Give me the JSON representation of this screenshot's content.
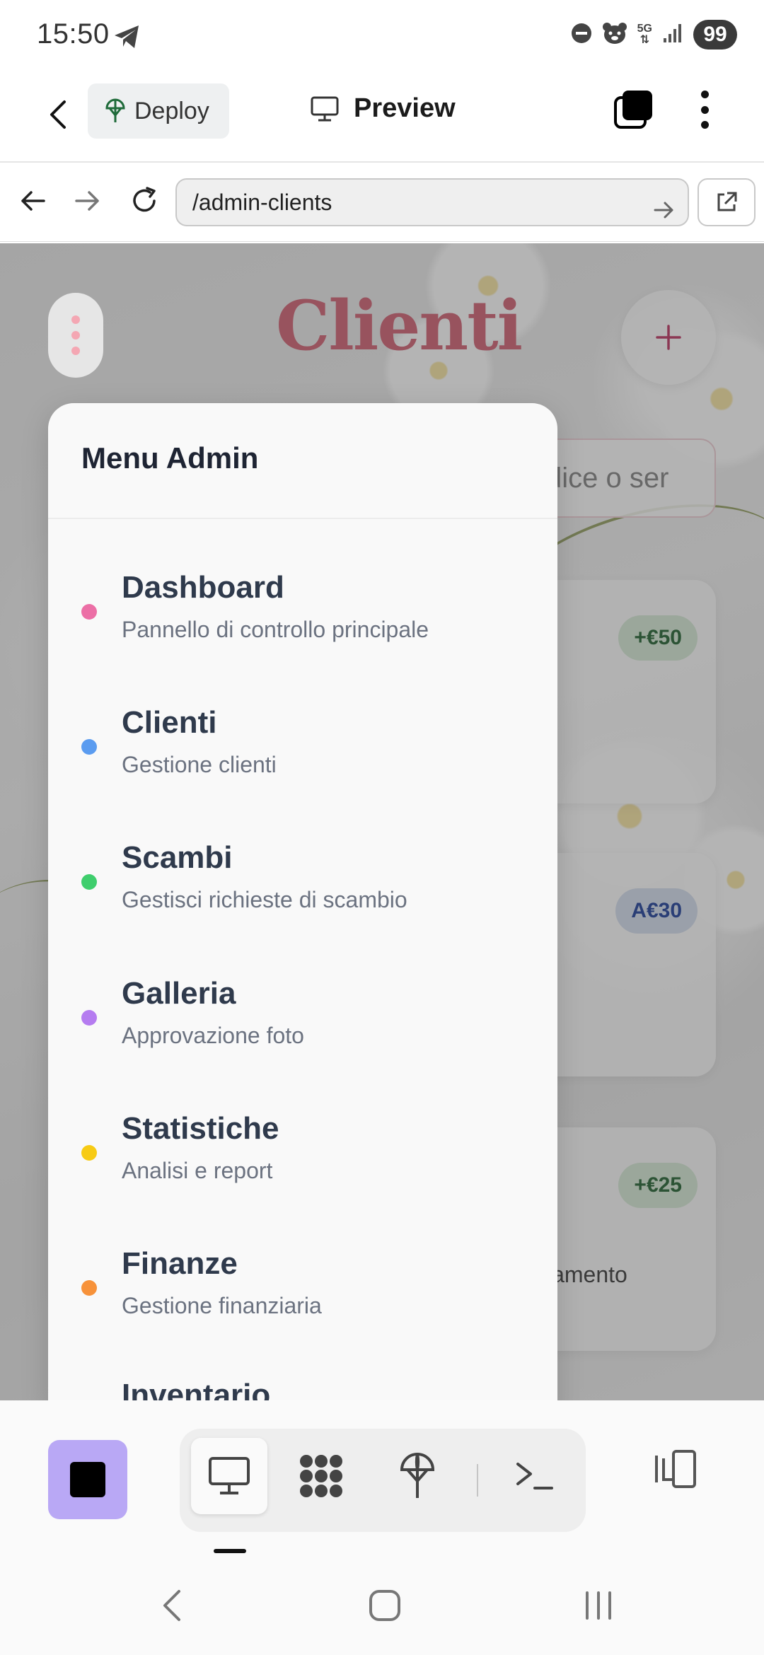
{
  "status_bar": {
    "time": "15:50",
    "network": "5G",
    "battery": "99",
    "icons": [
      "telegram-icon",
      "dnd-icon",
      "bear-icon",
      "data-arrows-icon",
      "signal-icon"
    ]
  },
  "app_header": {
    "deploy_label": "Deploy",
    "preview_label": "Preview"
  },
  "browser": {
    "url": "/admin-clients"
  },
  "page": {
    "title": "Clienti",
    "search_placeholder": "dice o ser",
    "cards": [
      {
        "badge": "+€50",
        "badge_color": "#2e6b3c",
        "note": ""
      },
      {
        "badge": "A€30",
        "badge_color": "#2b4aa0",
        "note": ""
      },
      {
        "badge": "+€25",
        "badge_color": "#2e6b3c",
        "note": "ppuntamento"
      }
    ]
  },
  "drawer": {
    "title": "Menu Admin",
    "items": [
      {
        "label": "Dashboard",
        "desc": "Pannello di controllo principale",
        "color": "#ec6fa6"
      },
      {
        "label": "Clienti",
        "desc": "Gestione clienti",
        "color": "#5b9cf0"
      },
      {
        "label": "Scambi",
        "desc": "Gestisci richieste di scambio",
        "color": "#3fce6d"
      },
      {
        "label": "Galleria",
        "desc": "Approvazione foto",
        "color": "#b57cf0"
      },
      {
        "label": "Statistiche",
        "desc": "Analisi e report",
        "color": "#f7cb15"
      },
      {
        "label": "Finanze",
        "desc": "Gestione finanziaria",
        "color": "#f7923a"
      },
      {
        "label": "Inventario",
        "desc": "",
        "color": "#9aa0a6"
      }
    ]
  },
  "toolbar": {
    "tools": [
      "preview-icon",
      "integrations-icon",
      "deploy-icon",
      "terminal-icon"
    ]
  }
}
